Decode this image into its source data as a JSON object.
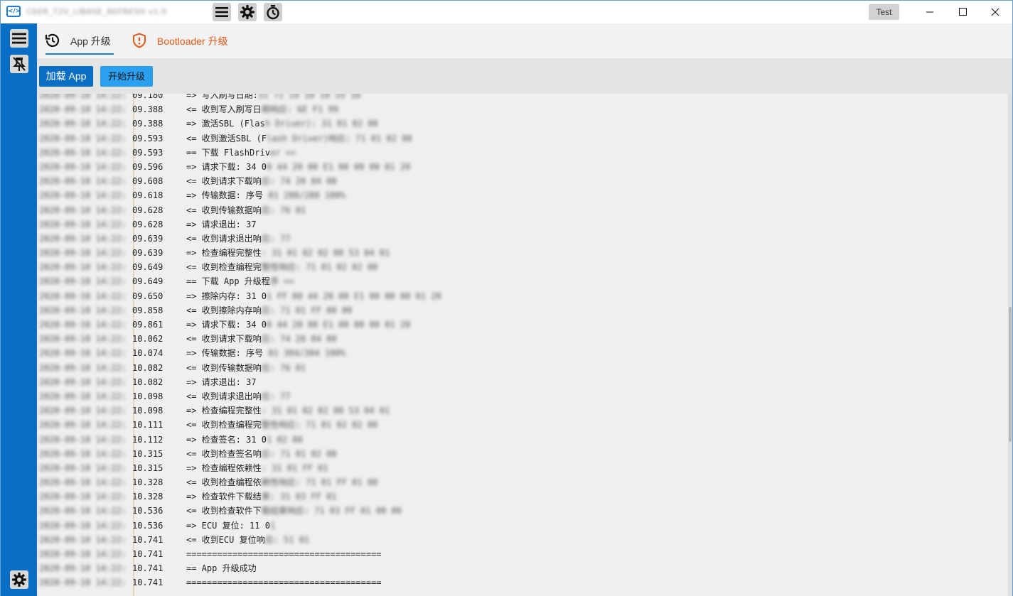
{
  "window": {
    "title": "CEER_T2V_LIBASE_REFRESH v1.0",
    "test_label": "Test"
  },
  "icons": {
    "logo": "app-logo-icon",
    "menu": "hamburger-menu-icon",
    "settings": "gear-icon",
    "timer": "stopwatch-icon",
    "minimize": "minimize-icon",
    "maximize": "maximize-icon",
    "close": "close-icon",
    "side_menu": "hamburger-menu-icon",
    "unpin": "unpin-icon",
    "side_settings": "gear-icon"
  },
  "colors": {
    "sidebar": "#0a6ec4",
    "accent": "#1a7ad4",
    "bootloader": "#e05a1a",
    "load_button": "#0a6ec4",
    "start_button": "#2b9ff0"
  },
  "tabs": [
    {
      "label": "App 升级",
      "icon": "refresh-clock-icon",
      "active": true
    },
    {
      "label": "Bootloader 升级",
      "icon": "shield-alert-icon",
      "active": false
    }
  ],
  "toolbar": {
    "load_app_label": "加载 App",
    "start_upgrade_label": "开始升级"
  },
  "log": [
    {
      "time": "09.180",
      "msg": "=> 写入刷写日期:",
      "hidden": "31 71 19 10 10 55 10"
    },
    {
      "time": "09.388",
      "msg": "<= 收到写入刷写日",
      "hidden": "期响应: 6E F1 99"
    },
    {
      "time": "09.388",
      "msg": "=> 激活SBL (Flas",
      "hidden": "h Driver): 31 01 02 00"
    },
    {
      "time": "09.593",
      "msg": "<= 收到激活SBL (F",
      "hidden": "lash Driver)响应: 71 01 02 00"
    },
    {
      "time": "09.593",
      "msg": "== 下载 FlashDriv",
      "hidden": "er =="
    },
    {
      "time": "09.596",
      "msg": "=> 请求下载: 34 0",
      "hidden": "0 44 20 00 E1 00 00 00 01 20"
    },
    {
      "time": "09.608",
      "msg": "<= 收到请求下载响",
      "hidden": "应: 74 20 04 00"
    },
    {
      "time": "09.618",
      "msg": "=> 传输数据: 序号",
      "hidden": " 01 288/288 100%"
    },
    {
      "time": "09.628",
      "msg": "<= 收到传输数据响",
      "hidden": "应: 76 01"
    },
    {
      "time": "09.628",
      "msg": "=> 请求退出: 37",
      "hidden": ""
    },
    {
      "time": "09.639",
      "msg": "<= 收到请求退出响",
      "hidden": "应: 77"
    },
    {
      "time": "09.639",
      "msg": "=> 检查编程完整性",
      "hidden": ": 31 01 02 02 00 53 04 01"
    },
    {
      "time": "09.649",
      "msg": "<= 收到检查编程完",
      "hidden": "整性响应: 71 01 02 02 00"
    },
    {
      "time": "09.649",
      "msg": "== 下载 App 升级程",
      "hidden": "序 =="
    },
    {
      "time": "09.650",
      "msg": "=> 擦除内存: 31 0",
      "hidden": "1 FF 00 44 20 00 E1 00 00 00 01 20"
    },
    {
      "time": "09.858",
      "msg": "<= 收到擦除内存响",
      "hidden": "应: 71 01 FF 00 00"
    },
    {
      "time": "09.861",
      "msg": "=> 请求下载: 34 0",
      "hidden": "0 44 20 00 E1 00 00 00 01 20"
    },
    {
      "time": "10.062",
      "msg": "<= 收到请求下载响",
      "hidden": "应: 74 20 04 00"
    },
    {
      "time": "10.074",
      "msg": "=> 传输数据: 序号",
      "hidden": " 01 304/304 100%"
    },
    {
      "time": "10.082",
      "msg": "<= 收到传输数据响",
      "hidden": "应: 76 01"
    },
    {
      "time": "10.082",
      "msg": "=> 请求退出: 37",
      "hidden": ""
    },
    {
      "time": "10.098",
      "msg": "<= 收到请求退出响",
      "hidden": "应: 77"
    },
    {
      "time": "10.098",
      "msg": "=> 检查编程完整性",
      "hidden": ": 31 01 02 02 00 53 04 01"
    },
    {
      "time": "10.111",
      "msg": "<= 收到检查编程完",
      "hidden": "整性响应: 71 01 02 02 00"
    },
    {
      "time": "10.112",
      "msg": "=> 检查签名: 31 0",
      "hidden": "1 02 00"
    },
    {
      "time": "10.315",
      "msg": "<= 收到检查签名响",
      "hidden": "应: 71 01 02 00"
    },
    {
      "time": "10.315",
      "msg": "=> 检查编程依赖性",
      "hidden": ": 31 01 FF 01"
    },
    {
      "time": "10.328",
      "msg": "<= 收到检查编程依",
      "hidden": "赖性响应: 71 01 FF 01 00"
    },
    {
      "time": "10.328",
      "msg": "=> 检查软件下载结",
      "hidden": "果: 31 03 FF 01"
    },
    {
      "time": "10.536",
      "msg": "<= 收到检查软件下",
      "hidden": "载结果响应: 71 03 FF 01 00 00"
    },
    {
      "time": "10.536",
      "msg": "=> ECU 复位: 11 0",
      "hidden": "1"
    },
    {
      "time": "10.741",
      "msg": "<= 收到ECU 复位响",
      "hidden": "应: 51 01"
    },
    {
      "time": "10.741",
      "msg": "======================================",
      "hidden": ""
    },
    {
      "time": "10.741",
      "msg": "== App 升级成功",
      "hidden": ""
    },
    {
      "time": "10.741",
      "msg": "======================================",
      "hidden": ""
    }
  ],
  "log_timestamp_prefix": "2020-09-10 14:22:"
}
